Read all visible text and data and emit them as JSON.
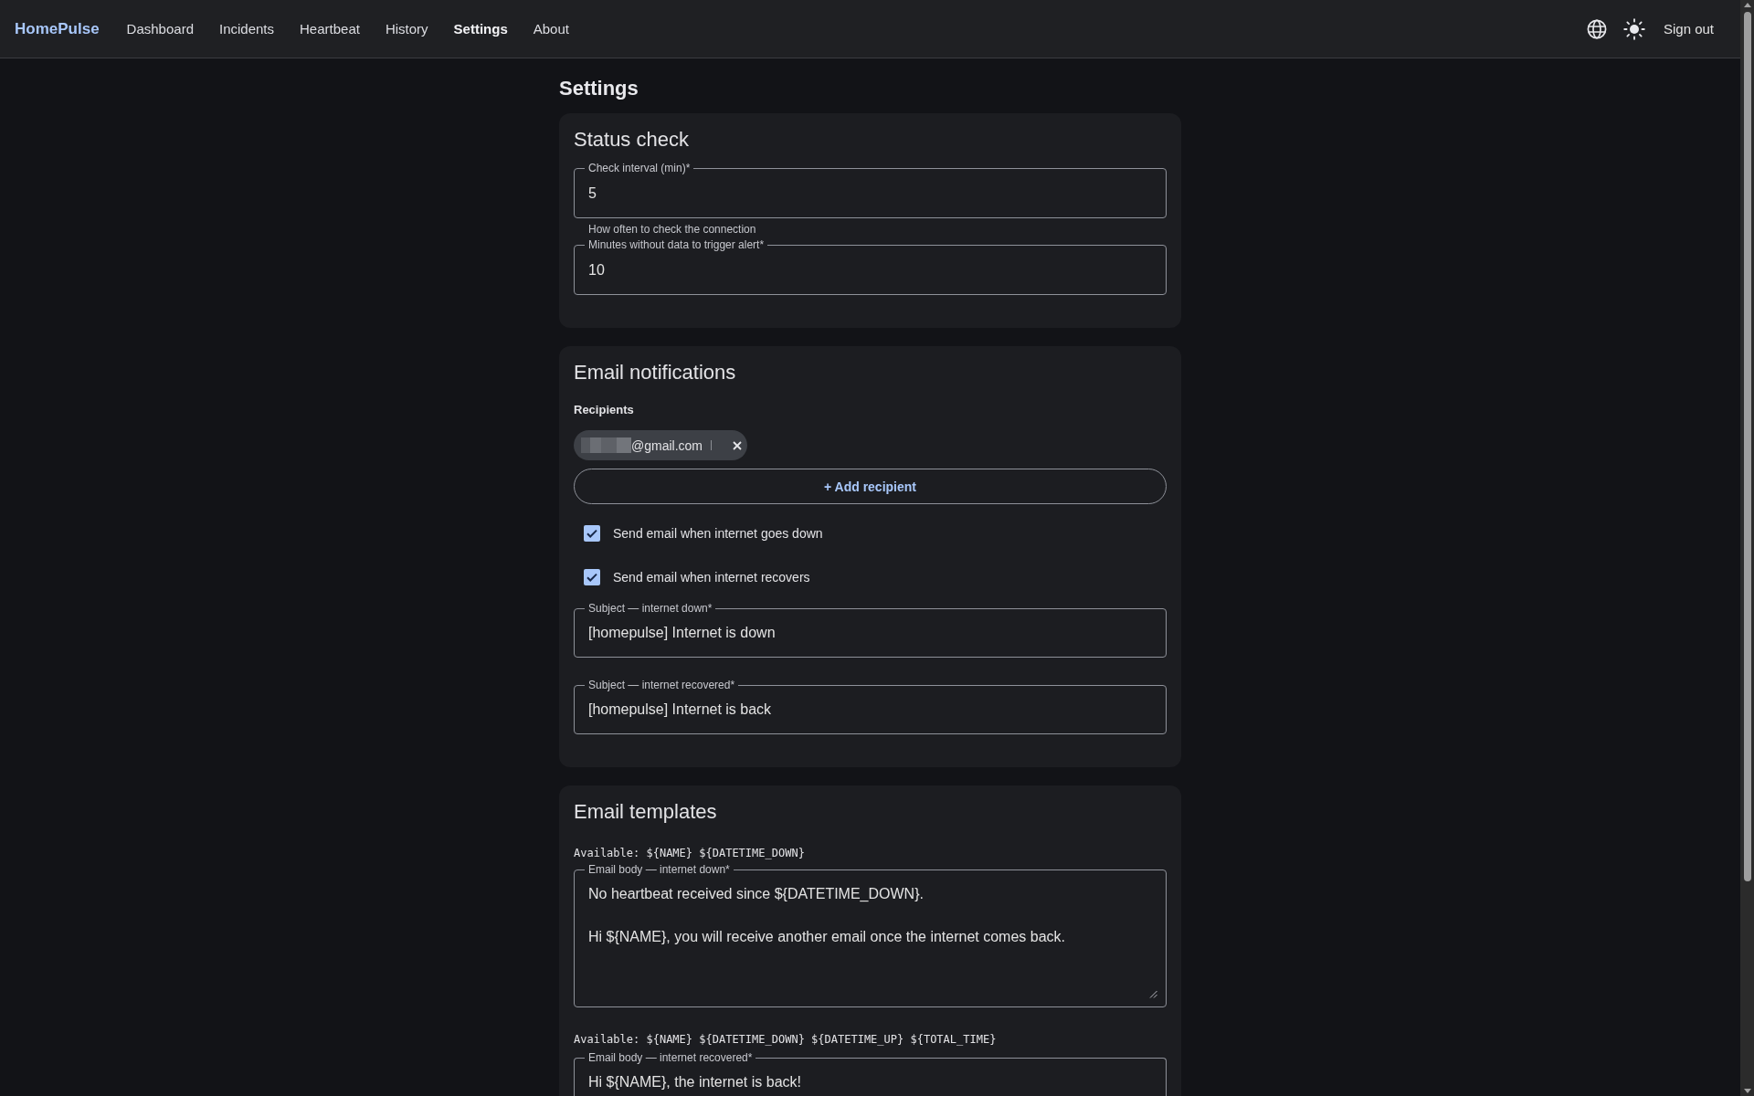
{
  "app": {
    "brand": "HomePulse",
    "nav": [
      {
        "label": "Dashboard",
        "selected": false
      },
      {
        "label": "Incidents",
        "selected": false
      },
      {
        "label": "Heartbeat",
        "selected": false
      },
      {
        "label": "History",
        "selected": false
      },
      {
        "label": "Settings",
        "selected": true
      },
      {
        "label": "About",
        "selected": false
      }
    ],
    "sign_out": "Sign out"
  },
  "page": {
    "title": "Settings"
  },
  "status_check": {
    "title": "Status check",
    "fields": [
      {
        "label": "Check interval (min)*",
        "value": "5",
        "helper": "How often to check the connection"
      },
      {
        "label": "Minutes without data to trigger alert*",
        "value": "10"
      }
    ]
  },
  "email_notifications": {
    "title": "Email notifications",
    "recipients_label": "Recipients",
    "recipients": [
      {
        "email": "@gmail.com",
        "redacted": true
      }
    ],
    "add_button": "+ Add recipient",
    "options": [
      {
        "label": "Send email when internet goes down",
        "checked": true
      },
      {
        "label": "Send email when internet recovers",
        "checked": true
      }
    ],
    "fields": [
      {
        "label": "Subject — internet down*",
        "value": "[homepulse] Internet is down"
      },
      {
        "label": "Subject — internet recovered*",
        "value": "[homepulse] Internet is back"
      }
    ]
  },
  "email_templates": {
    "title": "Email templates",
    "templates": [
      {
        "available": "Available: ${NAME} ${DATETIME_DOWN}",
        "label": "Email body — internet down*",
        "value": "No heartbeat received since ${DATETIME_DOWN}.\n\nHi ${NAME}, you will receive another email once the internet comes back."
      },
      {
        "available": "Available: ${NAME} ${DATETIME_DOWN} ${DATETIME_UP} ${TOTAL_TIME}",
        "label": "Email body — internet recovered*",
        "value": "Hi ${NAME}, the internet is back!"
      }
    ]
  }
}
